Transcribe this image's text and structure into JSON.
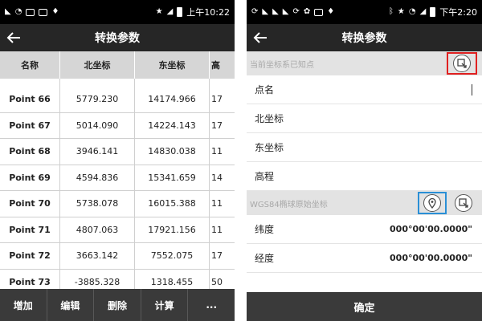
{
  "left": {
    "status": {
      "time": "上午10:22"
    },
    "title": "转换参数",
    "columns": [
      "名称",
      "北坐标",
      "东坐标",
      "高"
    ],
    "rows": [
      [
        "Point 66",
        "5779.230",
        "14174.966",
        "17"
      ],
      [
        "Point 67",
        "5014.090",
        "14224.143",
        "17"
      ],
      [
        "Point 68",
        "3946.141",
        "14830.038",
        "11"
      ],
      [
        "Point 69",
        "4594.836",
        "15341.659",
        "14"
      ],
      [
        "Point 70",
        "5738.078",
        "16015.388",
        "11"
      ],
      [
        "Point 71",
        "4807.063",
        "17921.156",
        "11"
      ],
      [
        "Point 72",
        "3663.142",
        "7552.075",
        "17"
      ],
      [
        "Point 73",
        "-3885.328",
        "1318.455",
        "50"
      ]
    ],
    "actions": [
      "增加",
      "编辑",
      "删除",
      "计算",
      "..."
    ]
  },
  "right": {
    "status": {
      "time": "下午2:20"
    },
    "title": "转换参数",
    "section_known": "当前坐标系已知点",
    "fields": {
      "point_name": "点名",
      "north": "北坐标",
      "east": "东坐标",
      "height": "高程"
    },
    "section_wgs": "WGS84椭球原始坐标",
    "latitude": {
      "label": "纬度",
      "value": "000°00'00.0000\""
    },
    "longitude": {
      "label": "经度",
      "value": "000°00'00.0000\""
    },
    "confirm": "确定"
  },
  "colors": {
    "status_bar": "#000000",
    "app_bar": "#262626",
    "bottom_bar": "#3a3a3a",
    "highlight_red": "#e02020",
    "highlight_blue": "#2a8fd6"
  },
  "icons": {
    "back": "arrow-left-icon",
    "import": "import-point-icon",
    "location": "location-pin-icon",
    "target": "target-icon"
  }
}
